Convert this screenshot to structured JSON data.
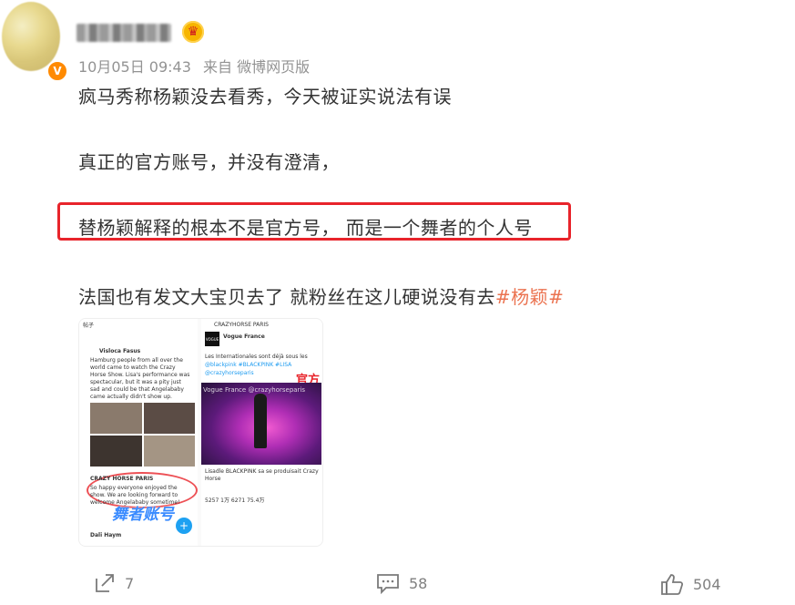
{
  "post": {
    "username_blurred": true,
    "meta": {
      "date": "10月05日 09:43",
      "source": "来自 微博网页版"
    },
    "paragraphs": [
      "疯马秀称杨颖没去看秀，今天被证实说法有误",
      "真正的官方账号，并没有澄清，",
      "替杨颖解释的根本不是官方号， 而是一个舞者的个人号"
    ],
    "last_line_text": "法国也有发文大宝贝去了 就粉丝在这儿硬说没有去",
    "hashtag": "#杨颖#",
    "highlight_color": "#e8242b",
    "link_color": "#eb7350",
    "embedded_image": {
      "left_header": "帖子",
      "left_user": "Visloca Fasus",
      "left_tweet": "Hamburg people from all over the world came to watch the Crazy Horse Show. Lisa's performance was spectacular, but it was a pity just sad and could be that Angelababy came actually didn't show up.",
      "left_reply_user": "CRAZY HORSE PARIS",
      "left_reply_text": "So happy everyone enjoyed the show. We are looking forward to welcome Angelababy sometime!",
      "left_third_user": "Dali Haym",
      "annotation_dancer": "舞者账号",
      "right_header": "CRAZYHORSE PARIS",
      "right_user": "Vogue France",
      "right_text": "Les Internationales sont déjà sous les",
      "right_tags": "@blackpink #BLACKPINK #LISA",
      "right_crazyhorse": "@crazyhorseparis",
      "right_watermark": "Vogue France @crazyhorseparis",
      "annotation_official": "官方",
      "right_caption": "Lisadle BLACKPINK sa se produisait Crazy Horse",
      "right_stats": "5257  1万  6271  75.4万"
    },
    "actions": {
      "share": "7",
      "comment": "58",
      "like": "504"
    }
  }
}
